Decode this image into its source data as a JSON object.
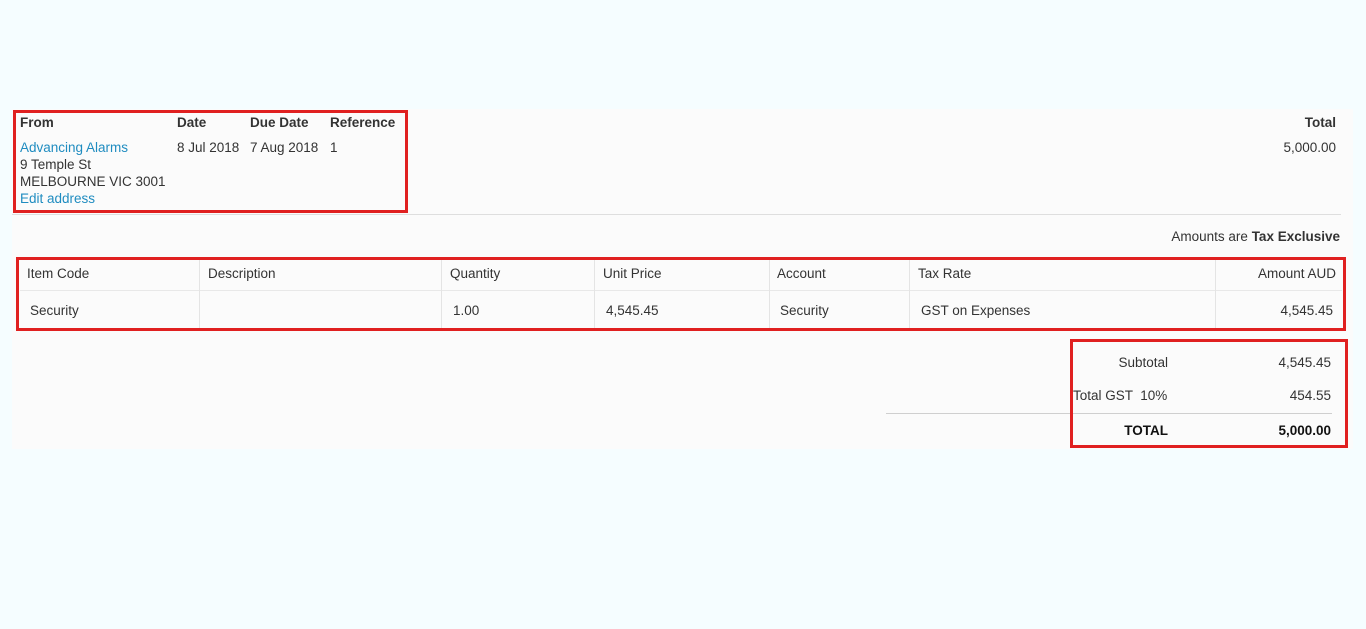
{
  "header": {
    "from_label": "From",
    "date_label": "Date",
    "due_date_label": "Due Date",
    "reference_label": "Reference",
    "total_label": "Total",
    "supplier_name": "Advancing Alarms",
    "address_line1": "9 Temple St",
    "address_line2": "MELBOURNE VIC 3001",
    "edit_address": "Edit address",
    "date": "8 Jul 2018",
    "due_date": "7 Aug 2018",
    "reference": "1",
    "total": "5,000.00"
  },
  "amounts": {
    "prefix": "Amounts are",
    "mode": "Tax Exclusive"
  },
  "table": {
    "columns": [
      "Item Code",
      "Description",
      "Quantity",
      "Unit Price",
      "Account",
      "Tax Rate",
      "Amount AUD"
    ],
    "rows": [
      [
        "Security",
        "",
        "1.00",
        "4,545.45",
        "Security",
        "GST on Expenses",
        "4,545.45"
      ]
    ]
  },
  "totals": {
    "subtotal_label": "Subtotal",
    "subtotal": "4,545.45",
    "gst_label": "Total GST  10%",
    "gst": "454.55",
    "total_label": "TOTAL",
    "total": "5,000.00"
  },
  "colors": {
    "highlight": "#e02020",
    "link": "#1f8cc0",
    "background": "#f5fdff"
  }
}
